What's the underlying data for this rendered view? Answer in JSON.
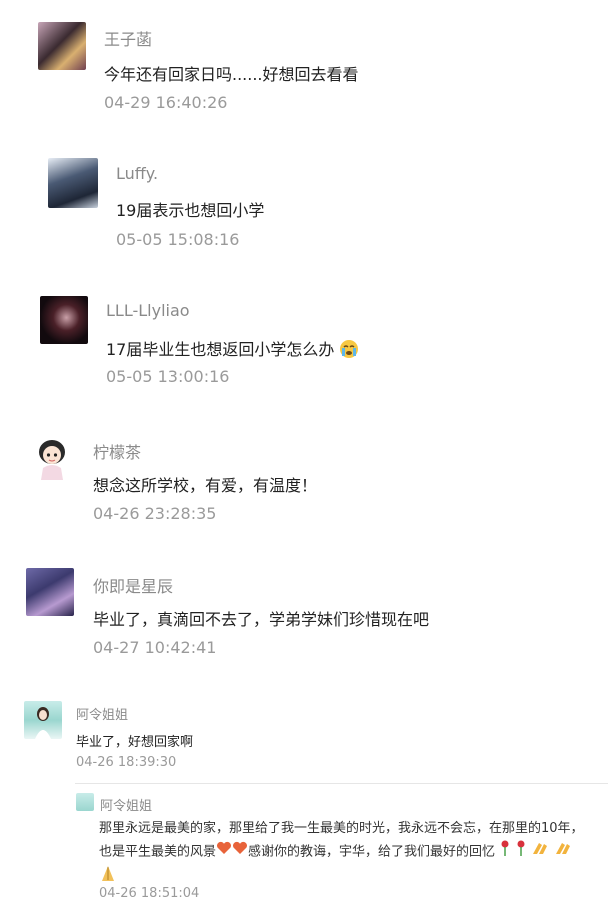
{
  "comments": [
    {
      "name": "王子菡",
      "text": "今年还有回家日吗......好想回去看看",
      "time": "04-29 16:40:26"
    },
    {
      "name": "Luffy.",
      "text": "19届表示也想回小学",
      "time": "05-05 15:08:16"
    },
    {
      "name": "LLL-Llyliao",
      "text": "17届毕业生也想返回小学怎么办",
      "time": "05-05 13:00:16"
    },
    {
      "name": "柠檬茶",
      "text": "想念这所学校，有爱，有温度！",
      "time": "04-26 23:28:35"
    },
    {
      "name": "你即是星辰",
      "text": "毕业了，真滴回不去了，学弟学妹们珍惜现在吧",
      "time": "04-27 10:42:41"
    },
    {
      "name": "阿令姐姐",
      "text": "毕业了，好想回家啊",
      "time": "04-26 18:39:30"
    }
  ],
  "reply": {
    "name": "阿令姐姐",
    "line1": "那里永远是最美的家，那里给了我一生最美的时光，我永远不会忘，在那里的10年，",
    "line2a": "也是平生最美的风景",
    "line2b": "感谢你的教诲，宇华，给了我们最好的回忆",
    "time": "04-26 18:51:04"
  }
}
